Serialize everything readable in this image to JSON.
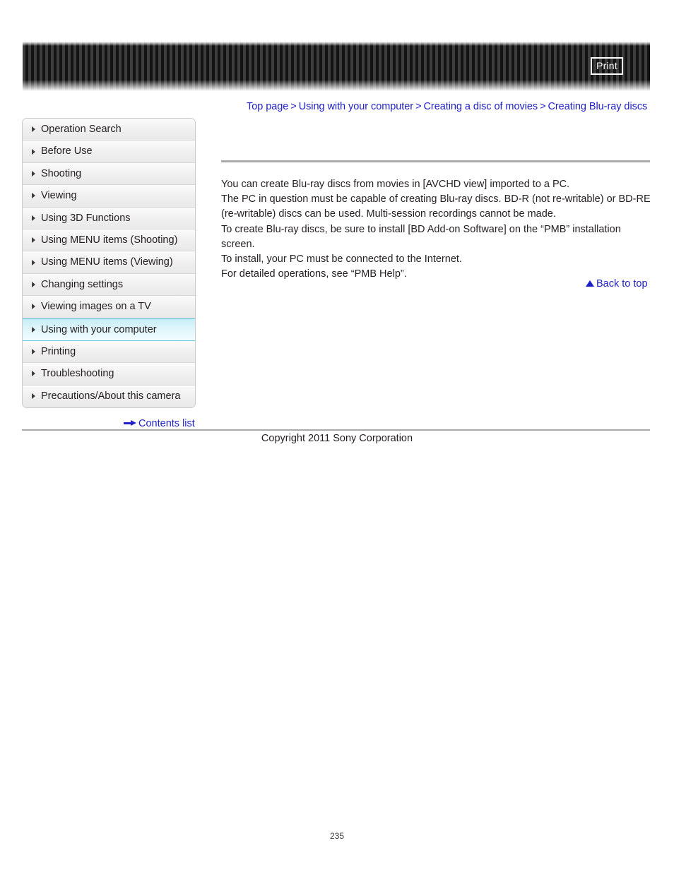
{
  "header": {
    "print_label": "Print"
  },
  "breadcrumb": {
    "separator": ">",
    "items": [
      {
        "label": "Top page"
      },
      {
        "label": "Using with your computer"
      },
      {
        "label": "Creating a disc of movies"
      },
      {
        "label": "Creating Blu-ray discs"
      }
    ]
  },
  "sidebar": {
    "items": [
      {
        "label": "Operation Search",
        "active": false
      },
      {
        "label": "Before Use",
        "active": false
      },
      {
        "label": "Shooting",
        "active": false
      },
      {
        "label": "Viewing",
        "active": false
      },
      {
        "label": "Using 3D Functions",
        "active": false
      },
      {
        "label": "Using MENU items (Shooting)",
        "active": false
      },
      {
        "label": "Using MENU items (Viewing)",
        "active": false
      },
      {
        "label": "Changing settings",
        "active": false
      },
      {
        "label": "Viewing images on a TV",
        "active": false
      },
      {
        "label": "Using with your computer",
        "active": true
      },
      {
        "label": "Printing",
        "active": false
      },
      {
        "label": "Troubleshooting",
        "active": false
      },
      {
        "label": "Precautions/About this camera",
        "active": false
      }
    ],
    "contents_list_label": "Contents list"
  },
  "main": {
    "paragraphs": [
      "You can create Blu-ray discs from movies in [AVCHD view] imported to a PC.",
      "The PC in question must be capable of creating Blu-ray discs. BD-R (not re-writable) or BD-RE",
      "(re-writable) discs can be used. Multi-session recordings cannot be made.",
      "To create Blu-ray discs, be sure to install [BD Add-on Software] on the “PMB” installation screen.",
      "To install, your PC must be connected to the Internet.",
      "For detailed operations, see “PMB Help”."
    ],
    "back_to_top_label": "Back to top"
  },
  "footer": {
    "copyright": "Copyright 2011 Sony Corporation",
    "page_number": "235"
  },
  "colors": {
    "link_blue": "#2020c8",
    "active_nav_border": "#5ecbe4",
    "rule_gray": "#a9a9a9",
    "text": "#231f20"
  }
}
